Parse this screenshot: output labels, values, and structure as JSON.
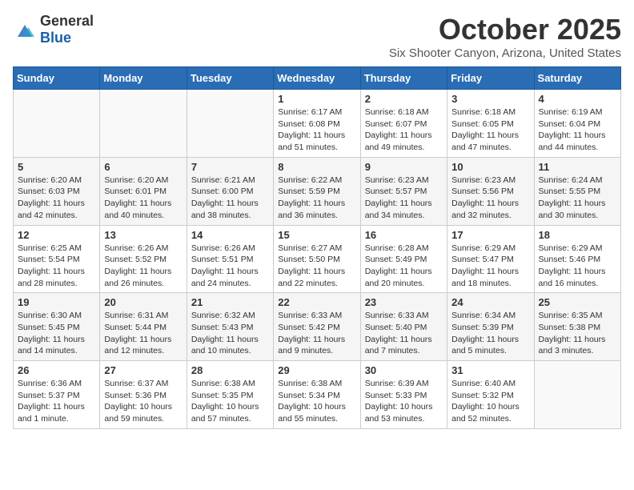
{
  "header": {
    "logo_general": "General",
    "logo_blue": "Blue",
    "month": "October 2025",
    "location": "Six Shooter Canyon, Arizona, United States"
  },
  "weekdays": [
    "Sunday",
    "Monday",
    "Tuesday",
    "Wednesday",
    "Thursday",
    "Friday",
    "Saturday"
  ],
  "weeks": [
    [
      {
        "day": "",
        "sunrise": "",
        "sunset": "",
        "daylight": ""
      },
      {
        "day": "",
        "sunrise": "",
        "sunset": "",
        "daylight": ""
      },
      {
        "day": "",
        "sunrise": "",
        "sunset": "",
        "daylight": ""
      },
      {
        "day": "1",
        "sunrise": "Sunrise: 6:17 AM",
        "sunset": "Sunset: 6:08 PM",
        "daylight": "Daylight: 11 hours and 51 minutes."
      },
      {
        "day": "2",
        "sunrise": "Sunrise: 6:18 AM",
        "sunset": "Sunset: 6:07 PM",
        "daylight": "Daylight: 11 hours and 49 minutes."
      },
      {
        "day": "3",
        "sunrise": "Sunrise: 6:18 AM",
        "sunset": "Sunset: 6:05 PM",
        "daylight": "Daylight: 11 hours and 47 minutes."
      },
      {
        "day": "4",
        "sunrise": "Sunrise: 6:19 AM",
        "sunset": "Sunset: 6:04 PM",
        "daylight": "Daylight: 11 hours and 44 minutes."
      }
    ],
    [
      {
        "day": "5",
        "sunrise": "Sunrise: 6:20 AM",
        "sunset": "Sunset: 6:03 PM",
        "daylight": "Daylight: 11 hours and 42 minutes."
      },
      {
        "day": "6",
        "sunrise": "Sunrise: 6:20 AM",
        "sunset": "Sunset: 6:01 PM",
        "daylight": "Daylight: 11 hours and 40 minutes."
      },
      {
        "day": "7",
        "sunrise": "Sunrise: 6:21 AM",
        "sunset": "Sunset: 6:00 PM",
        "daylight": "Daylight: 11 hours and 38 minutes."
      },
      {
        "day": "8",
        "sunrise": "Sunrise: 6:22 AM",
        "sunset": "Sunset: 5:59 PM",
        "daylight": "Daylight: 11 hours and 36 minutes."
      },
      {
        "day": "9",
        "sunrise": "Sunrise: 6:23 AM",
        "sunset": "Sunset: 5:57 PM",
        "daylight": "Daylight: 11 hours and 34 minutes."
      },
      {
        "day": "10",
        "sunrise": "Sunrise: 6:23 AM",
        "sunset": "Sunset: 5:56 PM",
        "daylight": "Daylight: 11 hours and 32 minutes."
      },
      {
        "day": "11",
        "sunrise": "Sunrise: 6:24 AM",
        "sunset": "Sunset: 5:55 PM",
        "daylight": "Daylight: 11 hours and 30 minutes."
      }
    ],
    [
      {
        "day": "12",
        "sunrise": "Sunrise: 6:25 AM",
        "sunset": "Sunset: 5:54 PM",
        "daylight": "Daylight: 11 hours and 28 minutes."
      },
      {
        "day": "13",
        "sunrise": "Sunrise: 6:26 AM",
        "sunset": "Sunset: 5:52 PM",
        "daylight": "Daylight: 11 hours and 26 minutes."
      },
      {
        "day": "14",
        "sunrise": "Sunrise: 6:26 AM",
        "sunset": "Sunset: 5:51 PM",
        "daylight": "Daylight: 11 hours and 24 minutes."
      },
      {
        "day": "15",
        "sunrise": "Sunrise: 6:27 AM",
        "sunset": "Sunset: 5:50 PM",
        "daylight": "Daylight: 11 hours and 22 minutes."
      },
      {
        "day": "16",
        "sunrise": "Sunrise: 6:28 AM",
        "sunset": "Sunset: 5:49 PM",
        "daylight": "Daylight: 11 hours and 20 minutes."
      },
      {
        "day": "17",
        "sunrise": "Sunrise: 6:29 AM",
        "sunset": "Sunset: 5:47 PM",
        "daylight": "Daylight: 11 hours and 18 minutes."
      },
      {
        "day": "18",
        "sunrise": "Sunrise: 6:29 AM",
        "sunset": "Sunset: 5:46 PM",
        "daylight": "Daylight: 11 hours and 16 minutes."
      }
    ],
    [
      {
        "day": "19",
        "sunrise": "Sunrise: 6:30 AM",
        "sunset": "Sunset: 5:45 PM",
        "daylight": "Daylight: 11 hours and 14 minutes."
      },
      {
        "day": "20",
        "sunrise": "Sunrise: 6:31 AM",
        "sunset": "Sunset: 5:44 PM",
        "daylight": "Daylight: 11 hours and 12 minutes."
      },
      {
        "day": "21",
        "sunrise": "Sunrise: 6:32 AM",
        "sunset": "Sunset: 5:43 PM",
        "daylight": "Daylight: 11 hours and 10 minutes."
      },
      {
        "day": "22",
        "sunrise": "Sunrise: 6:33 AM",
        "sunset": "Sunset: 5:42 PM",
        "daylight": "Daylight: 11 hours and 9 minutes."
      },
      {
        "day": "23",
        "sunrise": "Sunrise: 6:33 AM",
        "sunset": "Sunset: 5:40 PM",
        "daylight": "Daylight: 11 hours and 7 minutes."
      },
      {
        "day": "24",
        "sunrise": "Sunrise: 6:34 AM",
        "sunset": "Sunset: 5:39 PM",
        "daylight": "Daylight: 11 hours and 5 minutes."
      },
      {
        "day": "25",
        "sunrise": "Sunrise: 6:35 AM",
        "sunset": "Sunset: 5:38 PM",
        "daylight": "Daylight: 11 hours and 3 minutes."
      }
    ],
    [
      {
        "day": "26",
        "sunrise": "Sunrise: 6:36 AM",
        "sunset": "Sunset: 5:37 PM",
        "daylight": "Daylight: 11 hours and 1 minute."
      },
      {
        "day": "27",
        "sunrise": "Sunrise: 6:37 AM",
        "sunset": "Sunset: 5:36 PM",
        "daylight": "Daylight: 10 hours and 59 minutes."
      },
      {
        "day": "28",
        "sunrise": "Sunrise: 6:38 AM",
        "sunset": "Sunset: 5:35 PM",
        "daylight": "Daylight: 10 hours and 57 minutes."
      },
      {
        "day": "29",
        "sunrise": "Sunrise: 6:38 AM",
        "sunset": "Sunset: 5:34 PM",
        "daylight": "Daylight: 10 hours and 55 minutes."
      },
      {
        "day": "30",
        "sunrise": "Sunrise: 6:39 AM",
        "sunset": "Sunset: 5:33 PM",
        "daylight": "Daylight: 10 hours and 53 minutes."
      },
      {
        "day": "31",
        "sunrise": "Sunrise: 6:40 AM",
        "sunset": "Sunset: 5:32 PM",
        "daylight": "Daylight: 10 hours and 52 minutes."
      },
      {
        "day": "",
        "sunrise": "",
        "sunset": "",
        "daylight": ""
      }
    ]
  ]
}
